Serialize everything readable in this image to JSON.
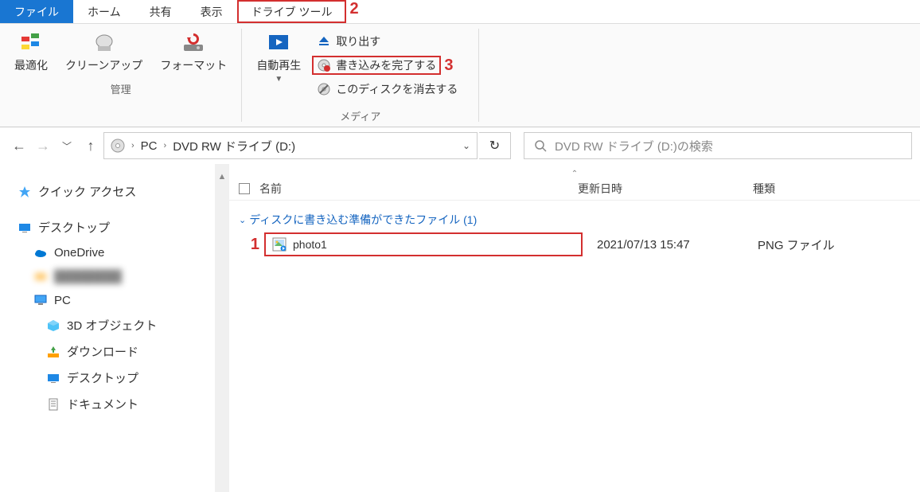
{
  "tabs": {
    "file": "ファイル",
    "home": "ホーム",
    "share": "共有",
    "view": "表示",
    "drivetools": "ドライブ ツール"
  },
  "annotations": {
    "a1": "1",
    "a2": "2",
    "a3": "3"
  },
  "ribbon": {
    "optimize": "最適化",
    "cleanup": "クリーンアップ",
    "format": "フォーマット",
    "manage_group": "管理",
    "autoplay": "自動再生",
    "eject": "取り出す",
    "finish_burn": "書き込みを完了する",
    "erase_disc": "このディスクを消去する",
    "media_group": "メディア"
  },
  "address": {
    "pc": "PC",
    "drive": "DVD RW ドライブ (D:)"
  },
  "search": {
    "placeholder": "DVD RW ドライブ (D:)の検索"
  },
  "columns": {
    "name": "名前",
    "date": "更新日時",
    "type": "種類"
  },
  "group": {
    "label": "ディスクに書き込む準備ができたファイル (1)"
  },
  "file": {
    "name": "photo1",
    "date": "2021/07/13 15:47",
    "type": "PNG ファイル"
  },
  "sidebar": {
    "quick": "クイック アクセス",
    "desktop": "デスクトップ",
    "onedrive": "OneDrive",
    "pc": "PC",
    "obj3d": "3D オブジェクト",
    "downloads": "ダウンロード",
    "desktop2": "デスクトップ",
    "documents": "ドキュメント"
  }
}
